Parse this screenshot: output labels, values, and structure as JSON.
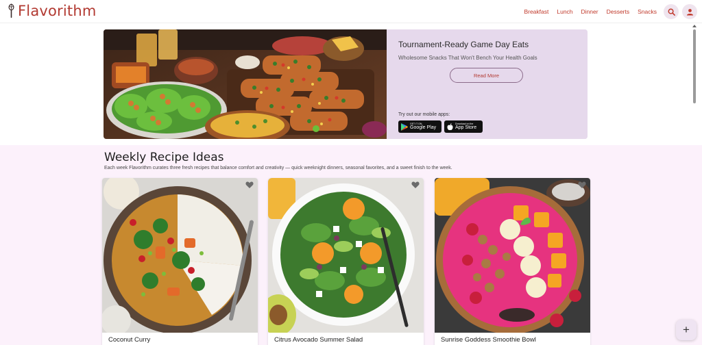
{
  "brand": {
    "name": "Flavorithm",
    "color": "#b23a32"
  },
  "nav": {
    "items": [
      "Breakfast",
      "Lunch",
      "Dinner",
      "Desserts",
      "Snacks"
    ]
  },
  "header": {
    "search_icon": "search-icon",
    "user_icon": "user-icon"
  },
  "hero": {
    "title": "Tournament-Ready Game Day Eats",
    "subtitle": "Wholesome Snacks That Won't Bench Your Health Goals",
    "button": "Read More",
    "apps_label": "Try out our mobile apps:",
    "google_play": {
      "small": "GET IT ON",
      "big": "Google Play"
    },
    "app_store": {
      "small": "Download on the",
      "big": "App Store"
    }
  },
  "weekly": {
    "title": "Weekly Recipe Ideas",
    "description": "Each week Flavorithm curates three fresh recipes that balance comfort and creativity — quick weeknight dinners, seasonal favorites, and a sweet finish to the week.",
    "cards": [
      {
        "title": "Coconut Curry"
      },
      {
        "title": "Citrus Avocado Summer Salad"
      },
      {
        "title": "Sunrise Goddess Smoothie Bowl"
      }
    ]
  },
  "fab": {
    "label": "+"
  },
  "colors": {
    "accent": "#c0392b",
    "hero_panel": "#e6d9ec",
    "weekly_bg": "#fcf1fb"
  }
}
